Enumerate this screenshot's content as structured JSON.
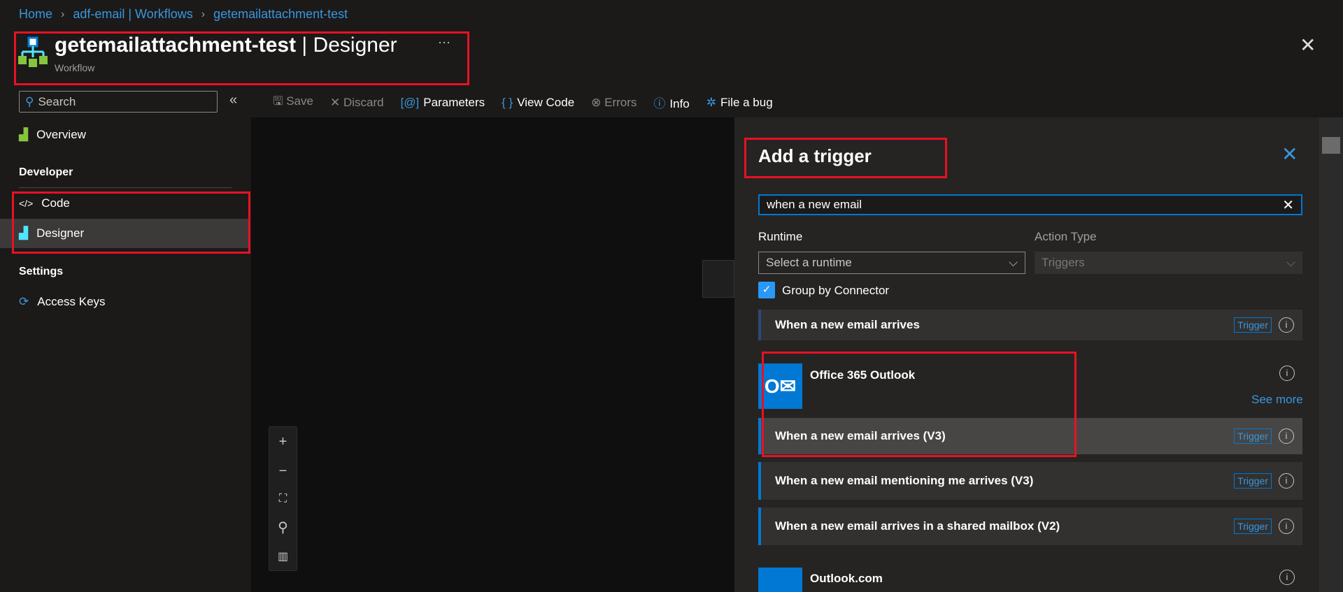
{
  "breadcrumb": [
    "Home",
    "adf-email | Workflows",
    "getemailattachment-test"
  ],
  "header": {
    "title": "getemailattachment-test",
    "title_suffix": " | Designer",
    "subtitle": "Workflow",
    "more": "···",
    "close": "✕"
  },
  "sidebar": {
    "search_placeholder": "Search",
    "collapse": "«",
    "items": [
      {
        "label": "Overview"
      },
      {
        "heading": "Developer"
      },
      {
        "label": "Code"
      },
      {
        "label": "Designer"
      },
      {
        "heading": "Settings"
      },
      {
        "label": "Access Keys"
      }
    ]
  },
  "toolbar": {
    "save": "Save",
    "discard": "Discard",
    "parameters": "Parameters",
    "view_code": "View Code",
    "errors": "Errors",
    "info": "Info",
    "bug": "File a bug"
  },
  "panel": {
    "title": "Add a trigger",
    "search_value": "when a new email",
    "runtime_label": "Runtime",
    "runtime_placeholder": "Select a runtime",
    "action_type_label": "Action Type",
    "action_type_value": "Triggers",
    "group_by": "Group by Connector",
    "group_by_checked": true,
    "first_item": "When a new email arrives",
    "connector1": {
      "name": "Office 365 Outlook",
      "see_more": "See more",
      "items": [
        "When a new email arrives (V3)",
        "When a new email mentioning me arrives (V3)",
        "When a new email arrives in a shared mailbox (V2)"
      ]
    },
    "connector2": {
      "name": "Outlook.com"
    },
    "badge": "Trigger"
  },
  "colors": {
    "accent": "#0078d4",
    "highlight": "#e81123"
  }
}
